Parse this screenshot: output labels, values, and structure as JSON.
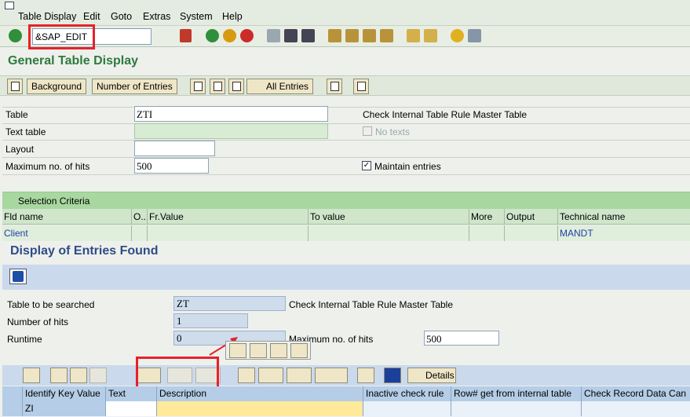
{
  "menu": [
    "Table Display",
    "Edit",
    "Goto",
    "Extras",
    "System",
    "Help"
  ],
  "command": {
    "value": "&SAP_EDIT"
  },
  "screen_title": "General Table Display",
  "app_toolbar": {
    "background": "Background",
    "num_entries": "Number of Entries",
    "all_entries": "All Entries"
  },
  "form": {
    "table_label": "Table",
    "table_value": "ZTI",
    "text_table_label": "Text table",
    "layout_label": "Layout",
    "max_hits_label": "Maximum no. of hits",
    "max_hits_value": "500",
    "table_desc": "Check Internal Table Rule Master Table",
    "no_texts": "No texts",
    "maintain": "Maintain entries"
  },
  "selection": {
    "title": "Selection Criteria",
    "columns": [
      "Fld name",
      "O...",
      "Fr.Value",
      "To value",
      "More",
      "Output",
      "Technical name"
    ],
    "row": {
      "fld": "Client",
      "tech": "MANDT"
    }
  },
  "results": {
    "title": "Display of Entries Found",
    "table_label": "Table to be searched",
    "table_value": "ZT",
    "table_desc": "Check Internal Table Rule Master Table",
    "hits_label": "Number of hits",
    "hits_value": "1",
    "runtime_label": "Runtime",
    "runtime_value": "0",
    "max_label": "Maximum no. of hits",
    "max_value": "500",
    "details": "Details"
  },
  "grid": {
    "columns": [
      "Identify Key Value",
      "Text",
      "Description",
      "Inactive check rule",
      "Row# get from internal table",
      "Check Record Data Can"
    ],
    "row": [
      "ZI",
      "",
      "",
      "",
      "",
      ""
    ]
  },
  "colors": {
    "highlight": "#e5222a",
    "title_green": "#2d7a3d",
    "title_blue": "#2f4c87"
  }
}
